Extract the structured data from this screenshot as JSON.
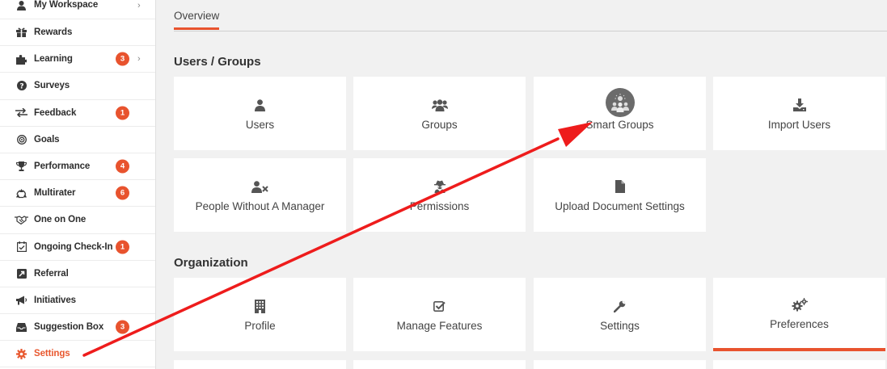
{
  "sidebar": {
    "items": [
      {
        "label": "My Workspace",
        "icon": "person-icon",
        "badge": null,
        "chevron": true
      },
      {
        "label": "Rewards",
        "icon": "gift-icon",
        "badge": null,
        "chevron": false
      },
      {
        "label": "Learning",
        "icon": "puzzle-icon",
        "badge": "3",
        "chevron": true
      },
      {
        "label": "Surveys",
        "icon": "question-icon",
        "badge": null,
        "chevron": false
      },
      {
        "label": "Feedback",
        "icon": "exchange-icon",
        "badge": "1",
        "chevron": false
      },
      {
        "label": "Goals",
        "icon": "target-icon",
        "badge": null,
        "chevron": false
      },
      {
        "label": "Performance",
        "icon": "trophy-icon",
        "badge": "4",
        "chevron": false
      },
      {
        "label": "Multirater",
        "icon": "recycle-icon",
        "badge": "6",
        "chevron": false
      },
      {
        "label": "One on One",
        "icon": "handshake-icon",
        "badge": null,
        "chevron": false
      },
      {
        "label": "Ongoing Check-In",
        "icon": "calendar-check-icon",
        "badge": "1",
        "chevron": false
      },
      {
        "label": "Referral",
        "icon": "share-icon",
        "badge": null,
        "chevron": false
      },
      {
        "label": "Initiatives",
        "icon": "bullhorn-icon",
        "badge": null,
        "chevron": false
      },
      {
        "label": "Suggestion Box",
        "icon": "inbox-icon",
        "badge": "3",
        "chevron": false
      },
      {
        "label": "Settings",
        "icon": "gear-icon",
        "badge": null,
        "chevron": false,
        "active": true
      }
    ]
  },
  "tabs": {
    "overview": "Overview"
  },
  "sections": {
    "users_groups": "Users / Groups",
    "organization": "Organization"
  },
  "cards": {
    "users": "Users",
    "groups": "Groups",
    "smart_groups": "Smart Groups",
    "import_users": "Import Users",
    "people_without_manager": "People Without A Manager",
    "permissions": "Permissions",
    "upload_document_settings": "Upload Document Settings",
    "profile": "Profile",
    "manage_features": "Manage Features",
    "settings": "Settings",
    "preferences": "Preferences"
  },
  "colors": {
    "accent": "#e8532e",
    "annotation_arrow": "#ee1c1c"
  }
}
